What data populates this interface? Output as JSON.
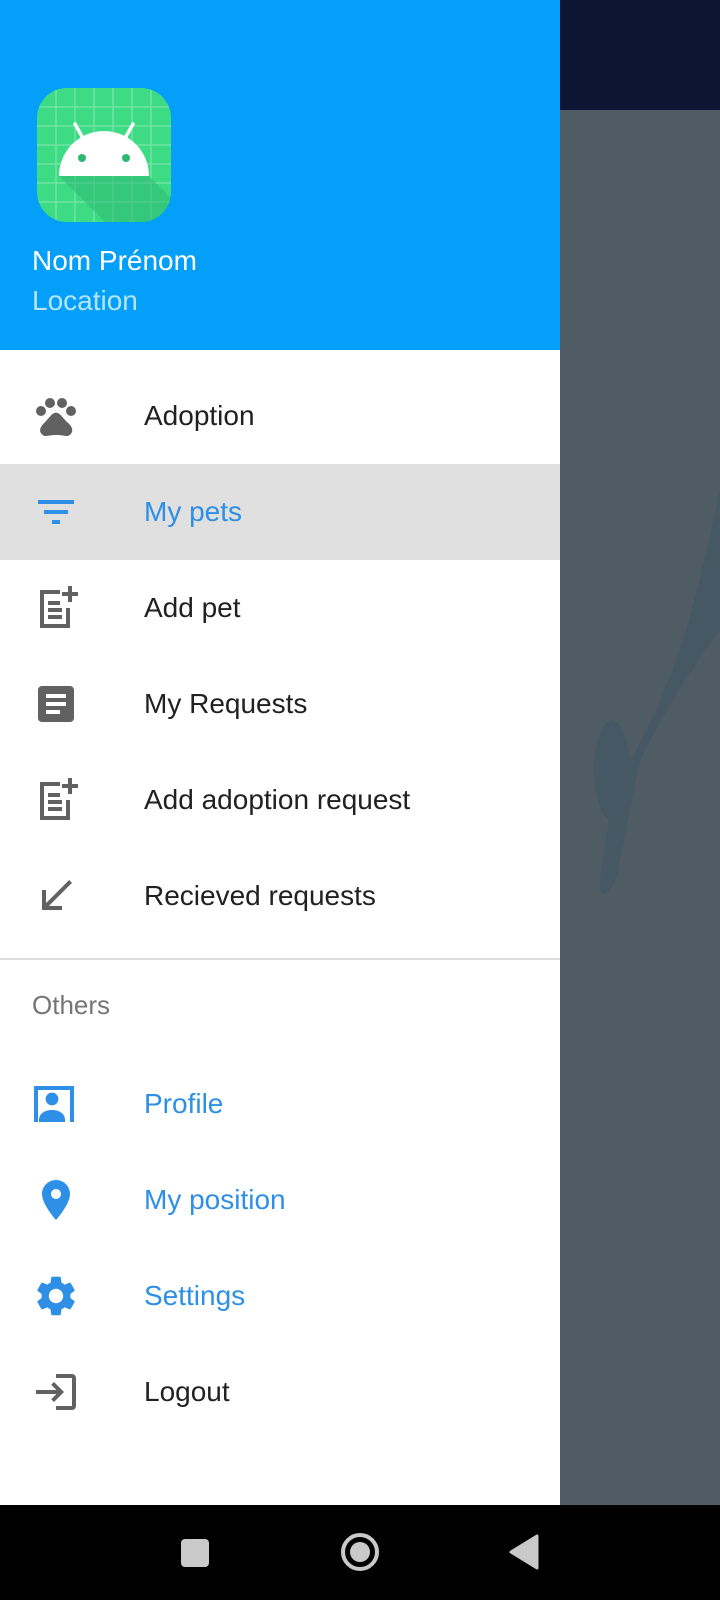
{
  "header": {
    "user_name": "Nom Prénom",
    "location": "Location",
    "colors": {
      "header_bg": "#039ff8",
      "location_text": "#b5e4ff"
    }
  },
  "menu": {
    "items": [
      {
        "label": "Adoption",
        "icon": "paw-icon"
      },
      {
        "label": "My pets",
        "icon": "filter-icon",
        "selected": true
      },
      {
        "label": "Add pet",
        "icon": "note-add-icon"
      },
      {
        "label": "My Requests",
        "icon": "document-icon"
      },
      {
        "label": "Add adoption request",
        "icon": "note-add-icon"
      },
      {
        "label": "Recieved requests",
        "icon": "arrow-down-left-icon"
      }
    ]
  },
  "others": {
    "title": "Others",
    "items": [
      {
        "label": "Profile",
        "icon": "contact-card-icon"
      },
      {
        "label": "My position",
        "icon": "location-pin-icon"
      },
      {
        "label": "Settings",
        "icon": "gear-icon"
      },
      {
        "label": "Logout",
        "icon": "login-icon"
      }
    ]
  },
  "navbar": {
    "buttons": [
      "recents-square-icon",
      "home-circle-icon",
      "back-triangle-icon"
    ]
  },
  "colors": {
    "accent": "#2d8fe6",
    "icon_gray": "#616161",
    "selected_bg": "#e0e0e0",
    "scrim": "#4f5c63"
  }
}
